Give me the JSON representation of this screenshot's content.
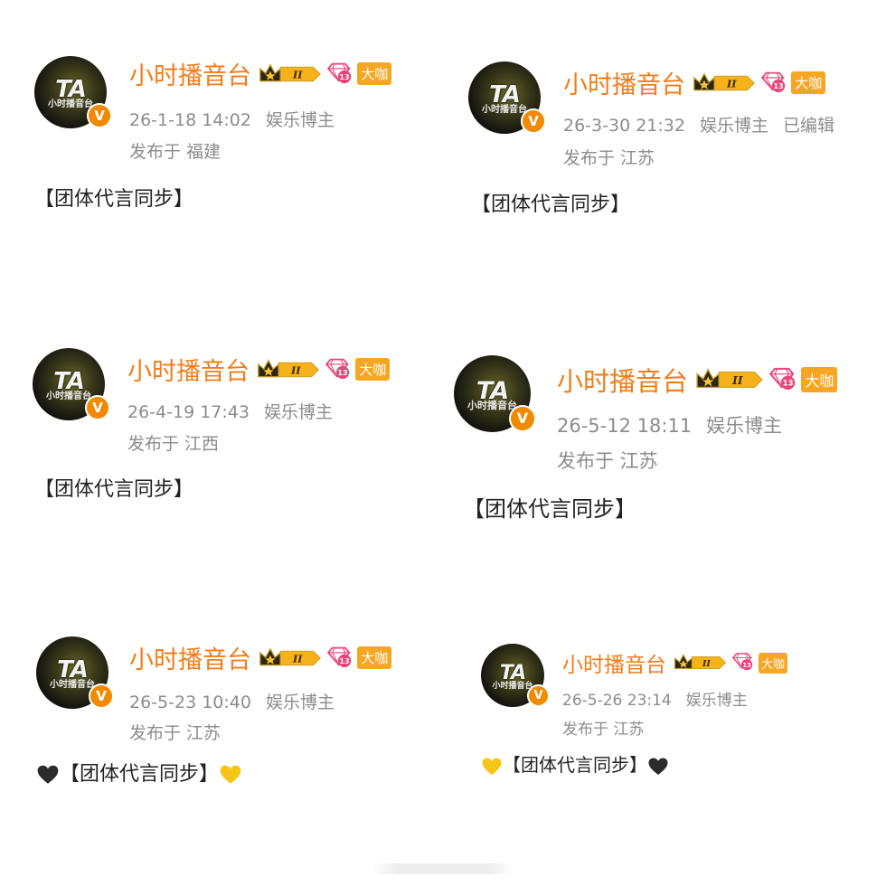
{
  "posts": [
    {
      "name": "小时播音台",
      "time": "26-1-18 14:02",
      "role": "娱乐博主",
      "edited": "",
      "location": "发布于 福建",
      "content": "【团体代言同步】",
      "prefix_heart": "",
      "suffix_heart": "",
      "crown_level": "II",
      "diamond_level": "13",
      "daka": "大咖"
    },
    {
      "name": "小时播音台",
      "time": "26-3-30 21:32",
      "role": "娱乐博主",
      "edited": "已编辑",
      "location": "发布于 江苏",
      "content": "【团体代言同步】",
      "prefix_heart": "",
      "suffix_heart": "",
      "crown_level": "II",
      "diamond_level": "13",
      "daka": "大咖"
    },
    {
      "name": "小时播音台",
      "time": "26-4-19 17:43",
      "role": "娱乐博主",
      "edited": "",
      "location": "发布于 江西",
      "content": "【团体代言同步】",
      "prefix_heart": "",
      "suffix_heart": "",
      "crown_level": "II",
      "diamond_level": "13",
      "daka": "大咖"
    },
    {
      "name": "小时播音台",
      "time": "26-5-12 18:11",
      "role": "娱乐博主",
      "edited": "",
      "location": "发布于 江苏",
      "content": "【团体代言同步】",
      "prefix_heart": "",
      "suffix_heart": "",
      "crown_level": "II",
      "diamond_level": "13",
      "daka": "大咖"
    },
    {
      "name": "小时播音台",
      "time": "26-5-23 10:40",
      "role": "娱乐博主",
      "edited": "",
      "location": "发布于 江苏",
      "content": "【团体代言同步】",
      "prefix_heart": "black-heart",
      "suffix_heart": "yellow-heart",
      "crown_level": "II",
      "diamond_level": "13",
      "daka": "大咖"
    },
    {
      "name": "小时播音台",
      "time": "26-5-26 23:14",
      "role": "娱乐博主",
      "edited": "",
      "location": "发布于 江苏",
      "content": "【团体代言同步】",
      "prefix_heart": "yellow-heart",
      "suffix_heart": "black-heart",
      "crown_level": "II",
      "diamond_level": "13",
      "daka": "大咖"
    }
  ],
  "avatar": {
    "logo_text": "TA",
    "logo_sub": "小时播音台",
    "verified_mark": "V"
  },
  "colors": {
    "name": "#f07d1a",
    "meta": "#8c8c8c",
    "verified": "#f08a00",
    "daka_bg": "#f6a623",
    "diamond": "#e8457a",
    "black_heart": "#2b2b2b",
    "yellow_heart": "#f5c518"
  }
}
